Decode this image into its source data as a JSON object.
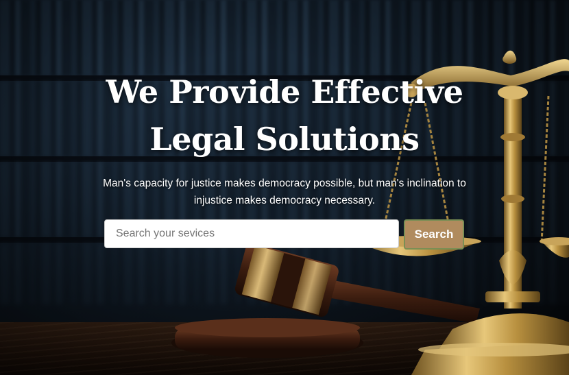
{
  "hero": {
    "title_line1": "We Provide Effective",
    "title_line2": "Legal Solutions",
    "subtitle": "Man's capacity for justice makes democracy possible, but man's inclination to injustice makes democracy necessary."
  },
  "search": {
    "placeholder": "Search your sevices",
    "value": "",
    "button_label": "Search"
  },
  "colors": {
    "button_bg": "#b08b5e",
    "button_border": "#7a8f55",
    "title_text": "#ffffff",
    "background": "#0b1118"
  },
  "images": {
    "background": "law-library-bookshelves",
    "left_object": "judge-gavel-on-sound-block",
    "right_object": "gold-scales-of-justice"
  }
}
